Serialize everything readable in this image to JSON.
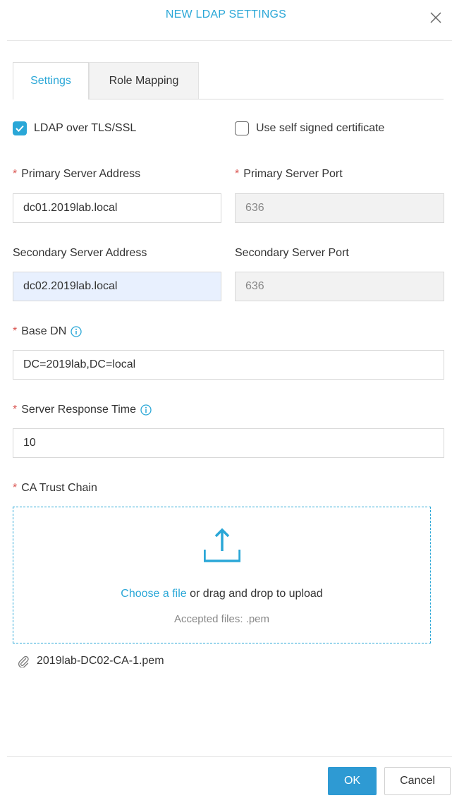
{
  "dialog": {
    "title": "NEW LDAP SETTINGS"
  },
  "tabs": [
    {
      "label": "Settings",
      "active": true
    },
    {
      "label": "Role Mapping",
      "active": false
    }
  ],
  "options": {
    "tls": {
      "label": "LDAP over TLS/SSL",
      "checked": true
    },
    "self_signed": {
      "label": "Use self signed certificate",
      "checked": false
    }
  },
  "fields": {
    "primary_address": {
      "label": "Primary Server Address",
      "value": "dc01.2019lab.local",
      "required": true
    },
    "primary_port": {
      "label": "Primary Server Port",
      "value": "636",
      "required": true,
      "disabled": true
    },
    "secondary_address": {
      "label": "Secondary Server Address",
      "value": "dc02.2019lab.local",
      "required": false
    },
    "secondary_port": {
      "label": "Secondary Server Port",
      "value": "636",
      "required": false,
      "disabled": true
    },
    "base_dn": {
      "label": "Base DN",
      "value": "DC=2019lab,DC=local",
      "required": true
    },
    "response_time": {
      "label": "Server Response Time",
      "value": "10",
      "required": true
    }
  },
  "upload": {
    "label": "CA Trust Chain",
    "link_text": "Choose a file",
    "rest_text": " or drag and drop to upload",
    "accepted": "Accepted files: .pem",
    "file_name": "2019lab-DC02-CA-1.pem"
  },
  "footer": {
    "ok_label": "OK",
    "cancel_label": "Cancel"
  },
  "colors": {
    "accent": "#2aa7d7",
    "required": "#d9534f",
    "ok_button": "#2e9ad3"
  },
  "required_mark": "*"
}
